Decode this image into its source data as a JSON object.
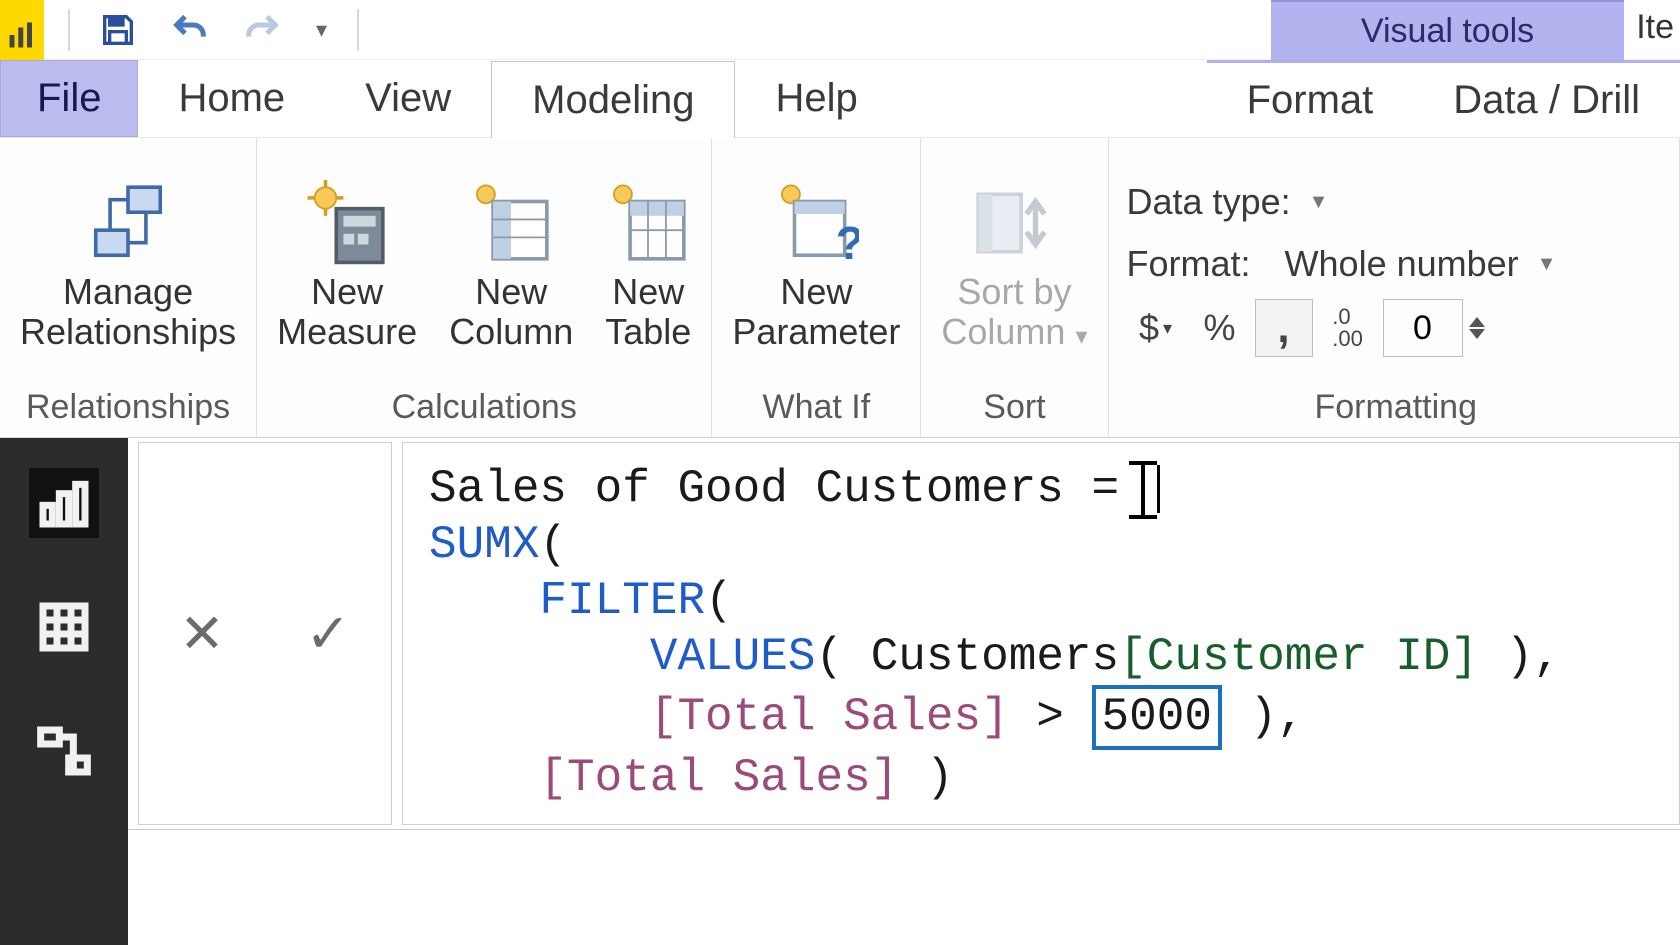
{
  "qat": {
    "save_tip": "Save",
    "undo_tip": "Undo",
    "redo_tip": "Redo"
  },
  "contextual": {
    "label": "Visual tools",
    "truncated": "Ite"
  },
  "tabs": {
    "file": "File",
    "home": "Home",
    "view": "View",
    "modeling": "Modeling",
    "help": "Help",
    "format": "Format",
    "datadrill": "Data / Drill"
  },
  "ribbon": {
    "relationships": {
      "manage": "Manage\nRelationships",
      "group": "Relationships"
    },
    "calculations": {
      "measure": "New\nMeasure",
      "column": "New\nColumn",
      "table": "New\nTable",
      "group": "Calculations"
    },
    "whatif": {
      "param": "New\nParameter",
      "group": "What If"
    },
    "sort": {
      "sortby": "Sort by\nColumn",
      "group": "Sort"
    },
    "formatting": {
      "datatype_label": "Data type:",
      "format_label": "Format:",
      "format_value": "Whole number",
      "currency": "$",
      "percent": "%",
      "thousands": ",",
      "decimals_icon": ".0\n.00",
      "decimals_value": "0",
      "group": "Formatting"
    }
  },
  "formula": {
    "measure_name": "Sales of Good Customers",
    "fn_sumx": "SUMX",
    "fn_filter": "FILTER",
    "fn_values": "VALUES",
    "table_ref": "Customers",
    "column_ref": "[Customer ID]",
    "measure_ref": "[Total Sales]",
    "threshold": "5000"
  },
  "canvas_bg_text": "Iter",
  "leftnav": {
    "report": "report-view",
    "data": "data-view",
    "model": "model-view"
  }
}
